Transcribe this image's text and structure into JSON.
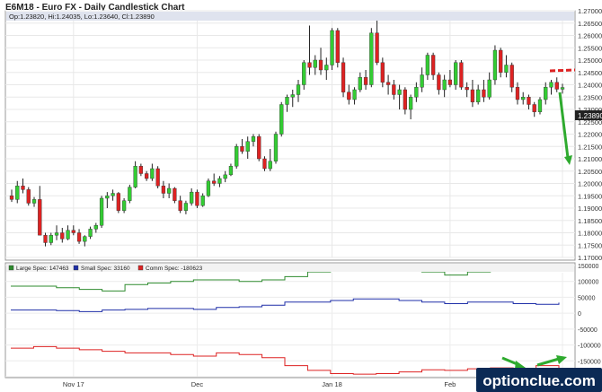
{
  "title": "E6M18 - Euro FX - Daily Candlestick Chart",
  "ohlc_readout": "Op:1.23820, Hi:1.24035, Lo:1.23640, Cl:1.23890",
  "last_price": "1.23890",
  "watermark": "optionclue.com",
  "colors": {
    "up": "#33cc33",
    "down": "#dd2222",
    "wick": "#222222",
    "large_spec": "#2e8b2e",
    "small_spec": "#1f2fa8",
    "comm_spec": "#dd2222",
    "annotation_arrow": "#2eaa2e",
    "annotation_dash": "#dd2222",
    "watermark_bg": "#0b2a55"
  },
  "chart_data": [
    {
      "type": "candlestick",
      "title": "E6M18 - Euro FX - Daily Candlestick Chart",
      "ylim": [
        1.17,
        1.27
      ],
      "y_ticks": [
        "1.17000",
        "1.17500",
        "1.18000",
        "1.18500",
        "1.19000",
        "1.19500",
        "1.20000",
        "1.20500",
        "1.21000",
        "1.21500",
        "1.22000",
        "1.22500",
        "1.23000",
        "1.23500",
        "1.24000",
        "1.24500",
        "1.25000",
        "1.25500",
        "1.26000",
        "1.26500",
        "1.27000"
      ],
      "x_tick_labels": [
        "Nov 17",
        "Dec",
        "Jan 18",
        "Feb",
        "Mar"
      ],
      "x_tick_index": [
        11,
        33,
        57,
        78,
        98
      ],
      "grid": true,
      "candles": [
        [
          1.195,
          1.1975,
          1.1925,
          1.1935
        ],
        [
          1.1935,
          1.201,
          1.192,
          1.199
        ],
        [
          1.199,
          1.202,
          1.196,
          1.1975
        ],
        [
          1.1975,
          1.1985,
          1.191,
          1.192
        ],
        [
          1.192,
          1.1945,
          1.1905,
          1.1935
        ],
        [
          1.1935,
          1.199,
          1.18,
          1.179
        ],
        [
          1.179,
          1.18,
          1.1745,
          1.176
        ],
        [
          1.176,
          1.18,
          1.175,
          1.179
        ],
        [
          1.179,
          1.183,
          1.177,
          1.18
        ],
        [
          1.18,
          1.182,
          1.176,
          1.1775
        ],
        [
          1.1775,
          1.183,
          1.177,
          1.181
        ],
        [
          1.181,
          1.183,
          1.179,
          1.18
        ],
        [
          1.18,
          1.1815,
          1.1755,
          1.1765
        ],
        [
          1.1765,
          1.179,
          1.1745,
          1.1785
        ],
        [
          1.1785,
          1.1825,
          1.1775,
          1.1815
        ],
        [
          1.1815,
          1.184,
          1.18,
          1.183
        ],
        [
          1.183,
          1.195,
          1.182,
          1.194
        ],
        [
          1.194,
          1.1965,
          1.19,
          1.195
        ],
        [
          1.195,
          1.1975,
          1.193,
          1.196
        ],
        [
          1.196,
          1.1965,
          1.188,
          1.189
        ],
        [
          1.189,
          1.194,
          1.188,
          1.193
        ],
        [
          1.193,
          1.1995,
          1.192,
          1.1985
        ],
        [
          1.1985,
          1.209,
          1.198,
          1.207
        ],
        [
          1.207,
          1.208,
          1.203,
          1.204
        ],
        [
          1.204,
          1.205,
          1.201,
          1.202
        ],
        [
          1.202,
          1.208,
          1.201,
          1.206
        ],
        [
          1.206,
          1.207,
          1.198,
          1.199
        ],
        [
          1.199,
          1.201,
          1.194,
          1.196
        ],
        [
          1.196,
          1.2,
          1.194,
          1.198
        ],
        [
          1.198,
          1.1985,
          1.192,
          1.193
        ],
        [
          1.193,
          1.195,
          1.188,
          1.189
        ],
        [
          1.189,
          1.193,
          1.1875,
          1.192
        ],
        [
          1.192,
          1.198,
          1.191,
          1.1965
        ],
        [
          1.1965,
          1.1975,
          1.19,
          1.191
        ],
        [
          1.191,
          1.196,
          1.1905,
          1.195
        ],
        [
          1.195,
          1.202,
          1.1945,
          1.201
        ],
        [
          1.201,
          1.204,
          1.199,
          1.2
        ],
        [
          1.2,
          1.203,
          1.1985,
          1.202
        ],
        [
          1.202,
          1.205,
          1.2005,
          1.2035
        ],
        [
          1.2035,
          1.208,
          1.203,
          1.207
        ],
        [
          1.207,
          1.216,
          1.206,
          1.215
        ],
        [
          1.215,
          1.218,
          1.212,
          1.213
        ],
        [
          1.213,
          1.219,
          1.21,
          1.217
        ],
        [
          1.217,
          1.22,
          1.215,
          1.219
        ],
        [
          1.219,
          1.22,
          1.209,
          1.21
        ],
        [
          1.21,
          1.211,
          1.205,
          1.206
        ],
        [
          1.206,
          1.214,
          1.205,
          1.209
        ],
        [
          1.209,
          1.221,
          1.208,
          1.22
        ],
        [
          1.22,
          1.233,
          1.219,
          1.232
        ],
        [
          1.232,
          1.236,
          1.229,
          1.235
        ],
        [
          1.235,
          1.238,
          1.231,
          1.236
        ],
        [
          1.236,
          1.242,
          1.233,
          1.24
        ],
        [
          1.24,
          1.25,
          1.238,
          1.249
        ],
        [
          1.249,
          1.264,
          1.244,
          1.247
        ],
        [
          1.247,
          1.252,
          1.244,
          1.25
        ],
        [
          1.25,
          1.255,
          1.244,
          1.246
        ],
        [
          1.246,
          1.251,
          1.242,
          1.248
        ],
        [
          1.248,
          1.263,
          1.246,
          1.262
        ],
        [
          1.262,
          1.263,
          1.247,
          1.249
        ],
        [
          1.249,
          1.251,
          1.235,
          1.237
        ],
        [
          1.237,
          1.24,
          1.232,
          1.234
        ],
        [
          1.234,
          1.239,
          1.232,
          1.238
        ],
        [
          1.238,
          1.245,
          1.237,
          1.243
        ],
        [
          1.243,
          1.246,
          1.238,
          1.24
        ],
        [
          1.24,
          1.263,
          1.239,
          1.261
        ],
        [
          1.261,
          1.266,
          1.248,
          1.249
        ],
        [
          1.249,
          1.251,
          1.239,
          1.241
        ],
        [
          1.241,
          1.244,
          1.236,
          1.24
        ],
        [
          1.24,
          1.242,
          1.234,
          1.236
        ],
        [
          1.236,
          1.24,
          1.23,
          1.238
        ],
        [
          1.238,
          1.239,
          1.228,
          1.23
        ],
        [
          1.23,
          1.236,
          1.226,
          1.235
        ],
        [
          1.235,
          1.241,
          1.233,
          1.239
        ],
        [
          1.239,
          1.247,
          1.237,
          1.244
        ],
        [
          1.244,
          1.253,
          1.242,
          1.252
        ],
        [
          1.252,
          1.253,
          1.242,
          1.244
        ],
        [
          1.244,
          1.245,
          1.236,
          1.238
        ],
        [
          1.238,
          1.244,
          1.235,
          1.242
        ],
        [
          1.242,
          1.246,
          1.239,
          1.24
        ],
        [
          1.24,
          1.25,
          1.238,
          1.249
        ],
        [
          1.249,
          1.25,
          1.238,
          1.239
        ],
        [
          1.239,
          1.241,
          1.235,
          1.238
        ],
        [
          1.238,
          1.242,
          1.231,
          1.233
        ],
        [
          1.233,
          1.24,
          1.232,
          1.238
        ],
        [
          1.238,
          1.242,
          1.233,
          1.235
        ],
        [
          1.235,
          1.245,
          1.234,
          1.242
        ],
        [
          1.242,
          1.256,
          1.24,
          1.254
        ],
        [
          1.254,
          1.255,
          1.243,
          1.245
        ],
        [
          1.245,
          1.252,
          1.243,
          1.248
        ],
        [
          1.248,
          1.249,
          1.237,
          1.239
        ],
        [
          1.239,
          1.241,
          1.232,
          1.234
        ],
        [
          1.234,
          1.237,
          1.232,
          1.235
        ],
        [
          1.235,
          1.236,
          1.23,
          1.232
        ],
        [
          1.232,
          1.233,
          1.227,
          1.229
        ],
        [
          1.229,
          1.235,
          1.228,
          1.234
        ],
        [
          1.234,
          1.241,
          1.232,
          1.239
        ],
        [
          1.239,
          1.242,
          1.236,
          1.241
        ],
        [
          1.241,
          1.243,
          1.237,
          1.2382
        ],
        [
          1.2382,
          1.2404,
          1.2364,
          1.2389
        ]
      ]
    },
    {
      "type": "line",
      "title": "COT positions",
      "ylim": [
        -200000,
        150000
      ],
      "y_ticks": [
        "150000",
        "100000",
        "50000",
        "0",
        "-50000",
        "-100000",
        "-150000",
        "-200000"
      ],
      "series": [
        {
          "name": "Large Spec: 147463",
          "color": "#2e8b2e",
          "values": [
            85000,
            85000,
            80000,
            75000,
            70000,
            90000,
            95000,
            100000,
            105000,
            105000,
            100000,
            105000,
            115000,
            130000,
            140000,
            145000,
            145000,
            140000,
            130000,
            120000,
            130000,
            135000,
            140000,
            145000,
            147463
          ]
        },
        {
          "name": "Small Spec: 33160",
          "color": "#1f2fa8",
          "values": [
            10000,
            10000,
            8000,
            5000,
            10000,
            12000,
            15000,
            15000,
            12000,
            18000,
            20000,
            25000,
            35000,
            35000,
            40000,
            45000,
            45000,
            40000,
            35000,
            30000,
            35000,
            35000,
            30000,
            28000,
            33160
          ]
        },
        {
          "name": "Comm Spec: -180623",
          "color": "#dd2222",
          "values": [
            -110000,
            -105000,
            -110000,
            -115000,
            -120000,
            -125000,
            -125000,
            -130000,
            -135000,
            -125000,
            -130000,
            -140000,
            -165000,
            -180000,
            -190000,
            -192000,
            -190000,
            -185000,
            -178000,
            -180000,
            -175000,
            -172000,
            -176000,
            -165000,
            -180623
          ]
        }
      ]
    }
  ]
}
